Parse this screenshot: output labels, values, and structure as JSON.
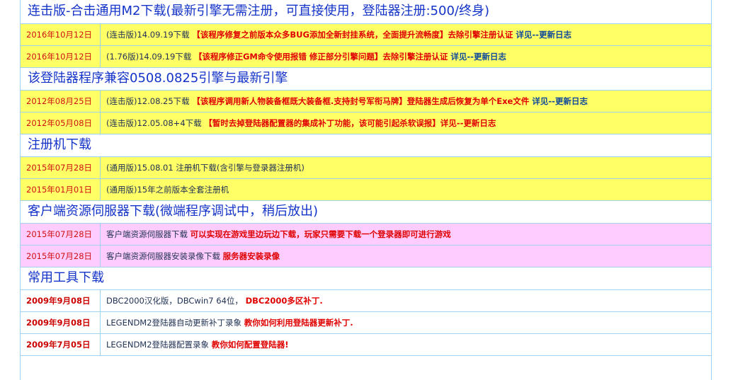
{
  "sections": [
    {
      "title": "连击版-合击通用M2下载(最新引擎无需注册，可直接使用，登陆器注册:500/终身)",
      "rows": [
        {
          "date": "2016年10月12日",
          "text": "(连击版)14.09.19下载",
          "highlight": "【该程序修复之前版本众多BUG添加全新封挂系统，全面提升流畅度】去除引擎注册认证",
          "tail": " 详见--更新日志"
        },
        {
          "date": "2016年10月12日",
          "text": "(1.76版)14.09.19下载",
          "highlight": "【该程序修正GM命令使用报错 修正部分引擎问题】去除引擎注册认证",
          "tail": " 详见--更新日志"
        }
      ]
    },
    {
      "title": "该登陆器程序兼容0508.0825引擎与最新引擎",
      "rows": [
        {
          "date": "2012年08月25日",
          "text": "(连击版)12.08.25下载",
          "highlight": "【该程序调用新人物装备框既大装备框.支持封号军衔马牌】登陆器生成后恢复为单个Exe文件",
          "tail": " 详见--更新日志"
        },
        {
          "date": "2012年05月08日",
          "text": "(连击版)12.05.08+4下载",
          "highlight": "【暂时去掉登陆器配置器的集成补丁功能，该可能引起杀软误报】详见--更新日志",
          "tail": ""
        }
      ]
    },
    {
      "title": "注册机下载",
      "rows": [
        {
          "date": "2015年07月28日",
          "text": "(通用版)15.08.01 注册机下载(含引擎与登录器注册机)",
          "highlight": "",
          "tail": ""
        },
        {
          "date": "2015年01月01日",
          "text": "(通用版)15年之前版本全套注册机",
          "highlight": "",
          "tail": ""
        }
      ]
    },
    {
      "title": "客户端资源伺服器下载(微端程序调试中，稍后放出)",
      "rows": [
        {
          "date": "2015年07月28日",
          "text": "客户端资源伺服器下载",
          "highlight": "可以实现在游戏里边玩边下载，玩家只需要下载一个登录器即可进行游戏",
          "tail": ""
        },
        {
          "date": "2015年07月28日",
          "text": "客户端资源伺服器安装录像下载",
          "highlight": "服务器安装录像",
          "tail": ""
        }
      ]
    },
    {
      "title": "常用工具下载",
      "rows": [
        {
          "date": "2009年9月08日",
          "text": "DBC2000汉化版，DBCwin7 64位，",
          "highlight": "DBC2000多区补丁.",
          "tail": ""
        },
        {
          "date": "2009年9月08日",
          "text": "LEGENDM2登陆器自动更新补丁录象",
          "highlight": "教你如何利用登陆器更新补丁.",
          "tail": ""
        },
        {
          "date": "2009年7月05日",
          "text": "LEGENDM2登陆器配置录象",
          "highlight": "教你如何配置登陆器!",
          "tail": ""
        }
      ]
    }
  ]
}
